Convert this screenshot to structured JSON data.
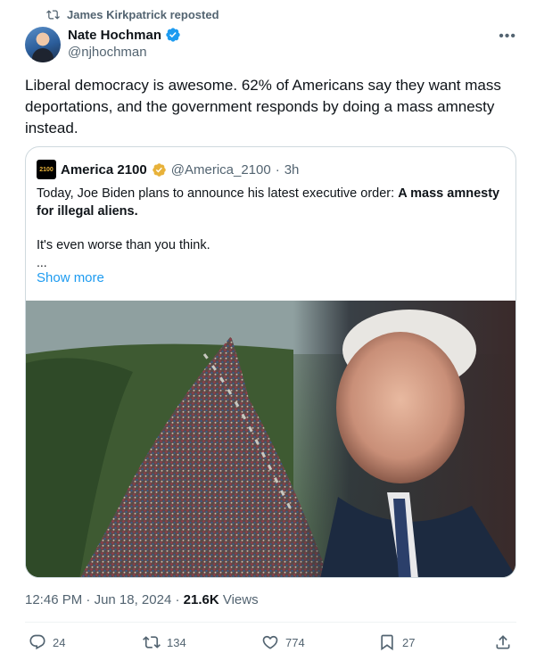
{
  "repost": {
    "text": "James Kirkpatrick reposted",
    "icon": "repost-icon"
  },
  "author": {
    "name": "Nate Hochman",
    "handle": "@njhochman",
    "verified": true
  },
  "tweet": {
    "text": "Liberal democracy is awesome. 62% of Americans say they want mass deportations, and the government responds by doing a mass amnesty instead."
  },
  "quote": {
    "logo_text": "2100",
    "name": "America 2100",
    "handle": "@America_2100",
    "separator": "·",
    "time": "3h",
    "text_prefix": "Today, Joe Biden plans to announce his latest executive order: ",
    "text_bold": "A mass amnesty for illegal aliens.",
    "text_second": "It's even worse than you think.",
    "ellipsis": "...",
    "show_more": "Show more"
  },
  "meta": {
    "time": "12:46 PM",
    "separator": "·",
    "date": "Jun 18, 2024",
    "separator2": "·",
    "views_count": "21.6K",
    "views_label": "Views"
  },
  "actions": {
    "replies": "24",
    "reposts": "134",
    "likes": "774",
    "bookmarks": "27"
  },
  "colors": {
    "accent": "#1d9bf0",
    "text": "#0f1419",
    "secondary": "#536471",
    "gold": "#e8b23a"
  }
}
